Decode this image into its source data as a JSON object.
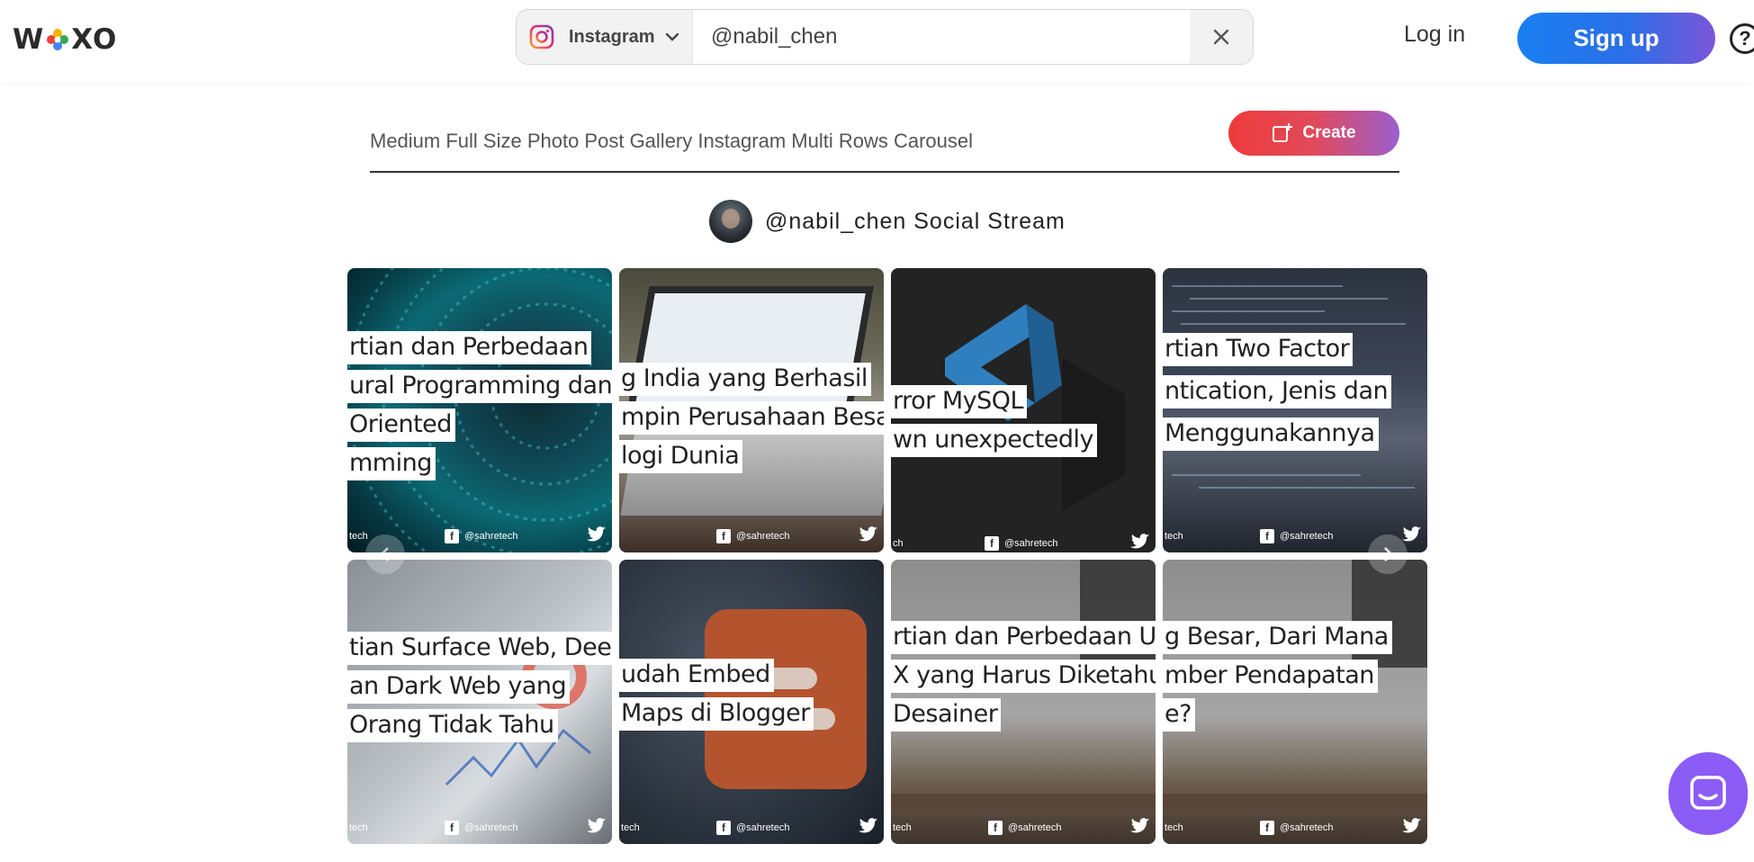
{
  "header": {
    "logo_text_left": "W",
    "logo_text_right": "XO",
    "platform_label": "Instagram",
    "search_value": "@nabil_chen",
    "login_label": "Log in",
    "signup_label": "Sign up",
    "help_label": "?"
  },
  "title_row": {
    "title": "Medium Full Size Photo Post Gallery Instagram Multi Rows Carousel",
    "create_label": "Create"
  },
  "stream": {
    "title": "@nabil_chen Social Stream"
  },
  "posts": [
    {
      "lines": [
        "rtian dan Perbedaan",
        "ural Programming dan",
        "Oriented",
        "mming"
      ],
      "handle": "@sahretech",
      "left_tag": "tech"
    },
    {
      "lines": [
        "g India yang Berhasil",
        "mpin Perusahaan Besar",
        "logi Dunia"
      ],
      "handle": "@sahretech",
      "left_tag": ""
    },
    {
      "lines": [
        "rror MySQL",
        "wn unexpectedly"
      ],
      "handle": "@sahretech",
      "left_tag": "ch"
    },
    {
      "lines": [
        "rtian Two Factor",
        "ntication, Jenis dan",
        "Menggunakannya"
      ],
      "handle": "@sahretech",
      "left_tag": "tech"
    },
    {
      "lines": [
        "tian Surface Web, Deep",
        "an Dark Web yang",
        "Orang Tidak Tahu"
      ],
      "handle": "@sahretech",
      "left_tag": "tech"
    },
    {
      "lines": [
        "udah Embed",
        "Maps di Blogger"
      ],
      "handle": "@sahretech",
      "left_tag": "tech"
    },
    {
      "lines": [
        "rtian dan Perbedaan UI",
        "X yang Harus Diketahui",
        "Desainer"
      ],
      "handle": "@sahretech",
      "left_tag": "tech"
    },
    {
      "lines": [
        "g Besar, Dari Mana",
        "mber Pendapatan",
        "e?"
      ],
      "handle": "@sahretech",
      "left_tag": "tech"
    }
  ],
  "colors": {
    "signup_gradient_start": "#1a7ff0",
    "signup_gradient_end": "#7c55d8",
    "create_gradient_start": "#ee3b3b",
    "create_gradient_end": "#9b5fcf",
    "chat_button": "#8b5cf6"
  },
  "icons": [
    "instagram-icon",
    "chevron-down-icon",
    "close-icon",
    "help-icon",
    "add-post-icon",
    "facebook-icon",
    "twitter-icon",
    "chevron-left-icon",
    "chevron-right-icon",
    "chat-icon"
  ]
}
